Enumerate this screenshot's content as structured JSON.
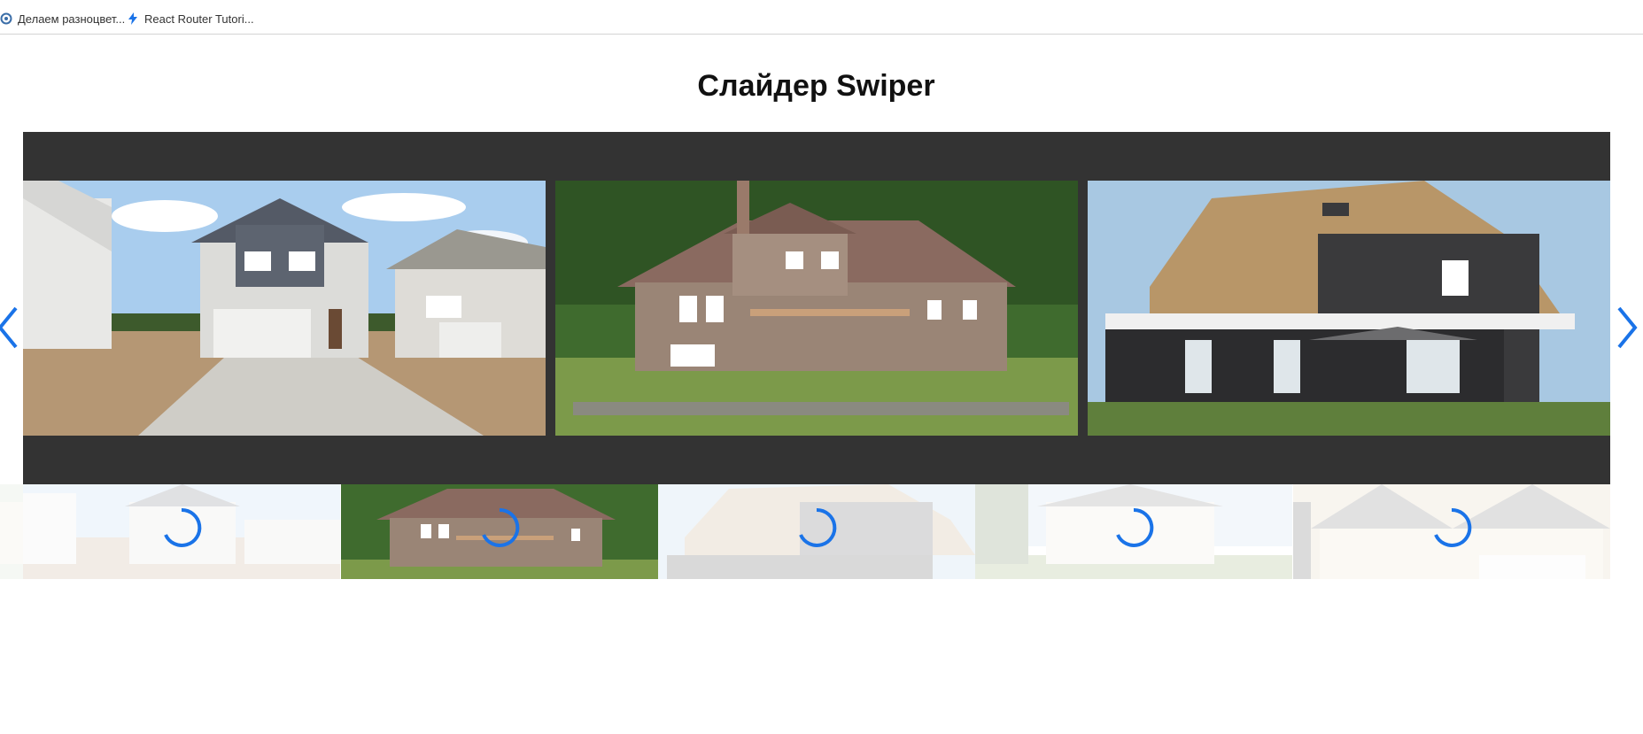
{
  "bookmarks": [
    {
      "label": "Делаем разноцвет...",
      "icon": "gear-icon"
    },
    {
      "label": "React Router Tutori...",
      "icon": "lightning-icon"
    }
  ],
  "page": {
    "title": "Слайдер Swiper"
  },
  "slider": {
    "slides": [
      {
        "image": "white-suburban-house-with-driveway"
      },
      {
        "image": "brick-house-with-deck-in-woods"
      },
      {
        "image": "thatched-roof-dark-house"
      }
    ],
    "prev_icon": "chevron-left-icon",
    "next_icon": "chevron-right-icon",
    "accent_color": "#1a73e8",
    "background_color": "#333333"
  },
  "thumbnails": {
    "items": [
      {
        "image": "white-suburban-house",
        "active": false,
        "loading": true
      },
      {
        "image": "brick-house-with-deck",
        "active": true,
        "loading": true
      },
      {
        "image": "thatched-roof-house",
        "active": false,
        "loading": true
      },
      {
        "image": "white-house-with-trees",
        "active": false,
        "loading": true
      },
      {
        "image": "beige-gabled-house",
        "active": false,
        "loading": true
      }
    ]
  }
}
